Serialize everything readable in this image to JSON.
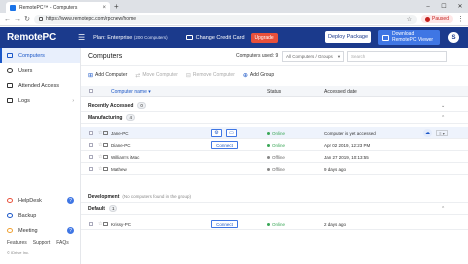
{
  "browser": {
    "tab_title": "RemotePC™ - Computers",
    "tab_close": "×",
    "new_tab": "+",
    "url": "https://www.remotepc.com/rpcnew/home",
    "profile_label": "Paused",
    "win_min": "–",
    "win_max": "☐",
    "win_close": "✕"
  },
  "header": {
    "logo": "RemotePC",
    "plan_label": "Plan: Enterprise",
    "plan_sub": "(200 Computers)",
    "change_card": "Change Credit Card",
    "upgrade": "Upgrade",
    "deploy": "Deploy Package",
    "download_line1": "Download",
    "download_line2": "RemotePC Viewer",
    "avatar_initial": "S"
  },
  "sidebar": {
    "items": [
      {
        "label": "Computers",
        "icon": "monitor-icon"
      },
      {
        "label": "Users",
        "icon": "user-icon"
      },
      {
        "label": "Attended Access",
        "icon": "attended-access-icon"
      },
      {
        "label": "Logs",
        "icon": "logs-icon"
      }
    ],
    "bottom_items": [
      {
        "label": "HelpDesk",
        "icon": "helpdesk-icon"
      },
      {
        "label": "Backup",
        "icon": "backup-icon"
      },
      {
        "label": "Meeting",
        "icon": "meeting-icon"
      }
    ],
    "links": [
      "Features",
      "Support",
      "FAQs"
    ],
    "copyright": "© IDrive Inc."
  },
  "main": {
    "title": "Computers",
    "computers_used": "Computers used: 9",
    "group_filter": "All Computers / Groups",
    "search_placeholder": "Search",
    "actions": {
      "add_computer": "Add Computer",
      "move_computer": "Move Computer",
      "remove_computer": "Remove Computer",
      "add_group": "Add Group"
    },
    "columns": {
      "name": "Computer name ▾",
      "status": "Status",
      "accessed": "Accessed date"
    },
    "connect_label": "Connect",
    "groups": [
      {
        "name": "Recently Accessed",
        "count": "0",
        "note": "",
        "rows": []
      },
      {
        "name": "Manufacturing",
        "count": "4",
        "note": "",
        "rows": [
          {
            "name": "Jane-PC",
            "status": "Online",
            "date": "Computer is yet accessed",
            "status_color": "#3aa757"
          },
          {
            "name": "Diane-PC",
            "status": "Online",
            "date": "Apr 02 2019, 12:23 PM",
            "status_color": "#3aa757"
          },
          {
            "name": "William's iMac",
            "status": "Offline",
            "date": "Jan 27 2019, 10:13:55",
            "status_color": "#888888"
          },
          {
            "name": "Mathew",
            "status": "Offline",
            "date": "9 days ago",
            "status_color": "#888888"
          }
        ]
      },
      {
        "name": "Development",
        "count": "",
        "note": "(No computers found in the group)",
        "rows": []
      },
      {
        "name": "Default",
        "count": "1",
        "note": "",
        "rows": [
          {
            "name": "Krissy-PC",
            "status": "Online",
            "date": "2 days ago",
            "status_color": "#3aa757"
          }
        ]
      }
    ]
  },
  "colors": {
    "header_bg": "#1b3a8c",
    "accent": "#3f76e4",
    "upgrade": "#e8503a",
    "online": "#3aa757",
    "offline": "#888888"
  }
}
